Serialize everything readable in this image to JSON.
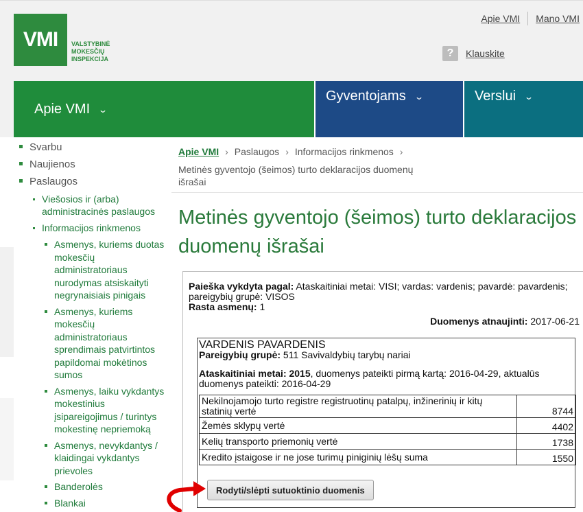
{
  "header": {
    "logo": "VMI",
    "logo_text": [
      "VALSTYBINĖ",
      "MOKESČIŲ",
      "INSPEKCIJA"
    ],
    "top_links": [
      "Apie VMI",
      "Mano VMI"
    ],
    "ask": {
      "icon": "question-icon",
      "label": "Klauskite"
    }
  },
  "nav": {
    "items": [
      "Apie VMI",
      "Gyventojams",
      "Verslui"
    ],
    "colors": {
      "apie": "#1f8c3b",
      "gyventojams": "#1d4a86",
      "verslui": "#0b6f80"
    }
  },
  "sidebar": {
    "top": [
      "Svarbu",
      "Naujienos",
      "Paslaugos"
    ],
    "level2": [
      "Viešosios ir (arba) administracinės paslaugos",
      "Informacijos rinkmenos"
    ],
    "level3": [
      "Asmenys, kuriems duotas mokesčių administratoriaus nurodymas atsiskaityti negrynaisiais pinigais",
      "Asmenys, kuriems mokesčių administratoriaus sprendimais patvirtintos papildomai mokėtinos sumos",
      "Asmenys, laiku vykdantys mokestinius įsipareigojimus / turintys mokestinę nepriemoką",
      "Asmenys, nevykdantys / klaidingai vykdantys prievoles",
      "Banderolės",
      "Blankai"
    ]
  },
  "breadcrumb": {
    "items": [
      "Apie VMI",
      "Paslaugos",
      "Informacijos rinkmenos"
    ],
    "current": "Metinės gyventojo (šeimos) turto deklaracijos duomenų išrašai"
  },
  "page_title": "Metinės gyventojo (šeimos) turto deklaracijos duomenų išrašai",
  "search": {
    "label": "Paieška vykdyta pagal:",
    "value": " Ataskaitiniai metai: VISI; vardas: vardenis; pavardė: pavardenis; pareigybių grupė: VISOS",
    "found_label": "Rasta asmenų:",
    "found_value": " 1",
    "updated_label": "Duomenys atnaujinti:",
    "updated_value": " 2017-06-21"
  },
  "record": {
    "name": "VARDENIS PAVARDENIS",
    "group_label": "Pareigybių grupė:",
    "group_value": " 511 Savivaldybių tarybų nariai",
    "year_label": "Ataskaitiniai metai: 2015",
    "year_value": ", duomenys pateikti pirmą kartą: 2016-04-29, aktualūs duomenys pateikti: 2016-04-29",
    "rows": [
      {
        "label": "Nekilnojamojo turto registre registruotinų patalpų, inžinerinių ir kitų statinių vertė",
        "value": "8744"
      },
      {
        "label": "Žemės sklypų vertė",
        "value": "4402"
      },
      {
        "label": "Kelių transporto priemonių vertė",
        "value": "1738"
      },
      {
        "label": "Kredito įstaigose ir ne jose turimų piniginių lėšų suma",
        "value": "1550"
      }
    ],
    "toggle_button": "Rodyti/slėpti sutuoktinio duomenis"
  }
}
